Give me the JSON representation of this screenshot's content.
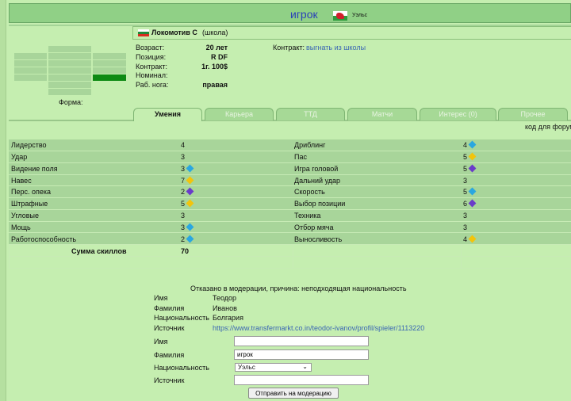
{
  "header": {
    "title": "игрок",
    "country": "Уэльс"
  },
  "club": {
    "name": "Локомотив С",
    "status": "(школа)"
  },
  "form_label": "Форма:",
  "info": [
    {
      "label": "Возраст:",
      "value": "20 лет"
    },
    {
      "label": "Позиция:",
      "value": "R DF"
    },
    {
      "label": "Контракт:",
      "value": "1г. 100$"
    },
    {
      "label": "Номинал:",
      "value": ""
    },
    {
      "label": "Раб. нога:",
      "value": "правая"
    }
  ],
  "contract": {
    "label": "Контракт:",
    "action": "выгнать из школы"
  },
  "tabs": [
    "Умения",
    "Карьера",
    "ТТД",
    "Матчи",
    "Интерес (0)",
    "Прочее"
  ],
  "active_tab": "Умения",
  "forum_code": "код для форума",
  "skills_left": [
    {
      "name": "Лидерство",
      "value": "4",
      "marker": ""
    },
    {
      "name": "Удар",
      "value": "3",
      "marker": ""
    },
    {
      "name": "Видение поля",
      "value": "3",
      "marker": "blue"
    },
    {
      "name": "Навес",
      "value": "7",
      "marker": "gold"
    },
    {
      "name": "Перс. опека",
      "value": "2",
      "marker": "purple"
    },
    {
      "name": "Штрафные",
      "value": "5",
      "marker": "gold"
    },
    {
      "name": "Угловые",
      "value": "3",
      "marker": ""
    },
    {
      "name": "Мощь",
      "value": "3",
      "marker": "blue"
    },
    {
      "name": "Работоспособность",
      "value": "2",
      "marker": "blue"
    }
  ],
  "skills_right": [
    {
      "name": "Дриблинг",
      "value": "4",
      "marker": "blue"
    },
    {
      "name": "Пас",
      "value": "5",
      "marker": "gold"
    },
    {
      "name": "Игра головой",
      "value": "5",
      "marker": "purple"
    },
    {
      "name": "Дальний удар",
      "value": "3",
      "marker": ""
    },
    {
      "name": "Скорость",
      "value": "5",
      "marker": "blue"
    },
    {
      "name": "Выбор позиции",
      "value": "6",
      "marker": "purple"
    },
    {
      "name": "Техника",
      "value": "3",
      "marker": ""
    },
    {
      "name": "Отбор мяча",
      "value": "3",
      "marker": ""
    },
    {
      "name": "Выносливость",
      "value": "4",
      "marker": "gold"
    }
  ],
  "skills_sum": {
    "label": "Сумма скиллов",
    "value": "70"
  },
  "moderation": {
    "reason": "Отказано в модерации, причина: неподходящая национальность",
    "current": [
      {
        "label": "Имя",
        "value": "Теодор"
      },
      {
        "label": "Фамилия",
        "value": "Иванов"
      },
      {
        "label": "Национальность",
        "value": "Болгария"
      },
      {
        "label": "Источник",
        "value": "https://www.transfermarkt.co.in/teodor-ivanov/profil/spieler/1113220"
      }
    ],
    "form": {
      "first_name_label": "Имя",
      "first_name_value": "",
      "last_name_label": "Фамилия",
      "last_name_value": "игрок",
      "nationality_label": "Национальность",
      "nationality_value": "Уэльс",
      "source_label": "Источник",
      "source_value": "",
      "submit_label": "Отправить на модерацию"
    }
  },
  "colors": {
    "accent_link": "#3a66b3",
    "header_title": "#2a3fb8",
    "background": "#c5eeb0",
    "form_bar": "#0e8a14"
  }
}
